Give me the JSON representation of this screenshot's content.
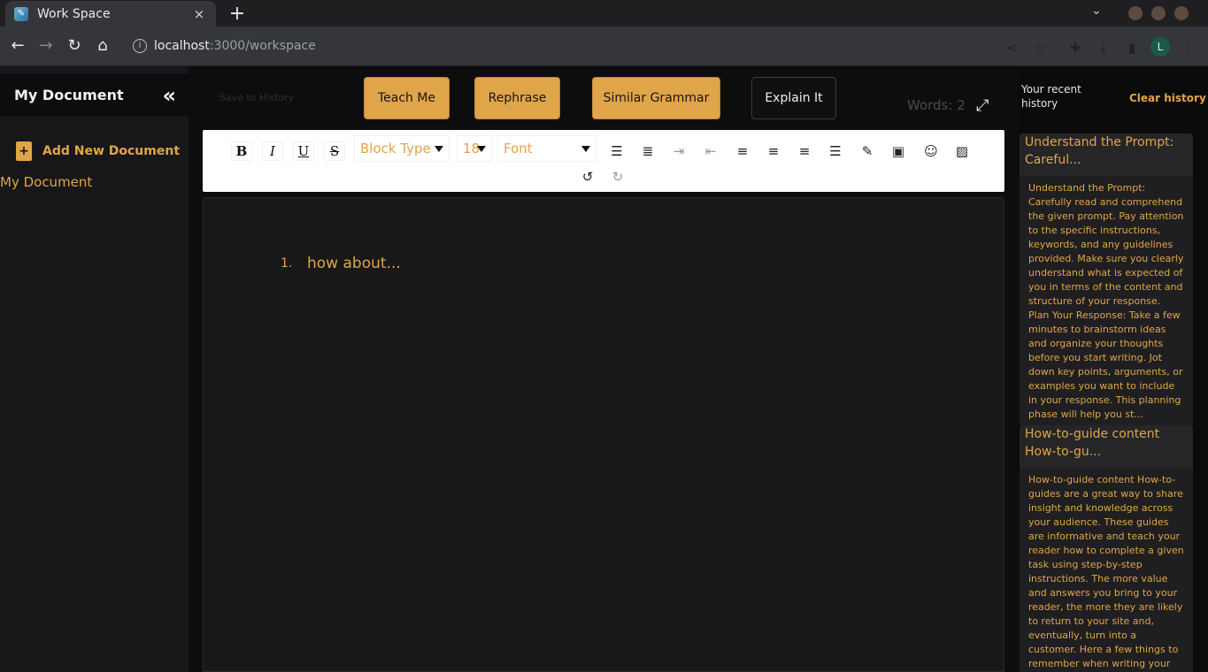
{
  "browser": {
    "tab_title": "Work Space",
    "tab_close": "×",
    "new_tab": "+",
    "url_host": "localhost",
    "url_path": ":3000/workspace",
    "profile_initial": "L"
  },
  "sidebar": {
    "title": "My Document",
    "collapse_icon": "«",
    "add_label": "Add New Document",
    "documents": [
      "My Document"
    ]
  },
  "main": {
    "save_to_history": "Save to History",
    "buttons": {
      "teach": "Teach Me",
      "rephrase": "Rephrase",
      "similar": "Similar Grammar",
      "explain": "Explain It"
    },
    "words": "Words: 2",
    "toolbar": {
      "bold": "B",
      "italic": "I",
      "underline": "U",
      "strike": "S",
      "block_type": "Block Type",
      "font_size": "18",
      "font": "Font"
    },
    "editor": {
      "list_number": "1.",
      "list_text": "how about..."
    }
  },
  "history": {
    "header": "Your recent history",
    "clear": "Clear history",
    "items": [
      {
        "title": "Understand the Prompt: Careful...",
        "body": "Understand the Prompt: Carefully read and comprehend the given prompt. Pay attention to the specific instructions, keywords, and any guidelines provided. Make sure you clearly understand what is expected of you in terms of the content and structure of your response. Plan Your Response: Take a few minutes to brainstorm ideas and organize your thoughts before you start writing. Jot down key points, arguments, or examples you want to include in your response. This planning phase will help you st..."
      },
      {
        "title": "How-to-guide content How-to-gu...",
        "body": "How-to-guide content How-to-guides are a great way to share insight and knowledge across your audience. These guides are informative and teach your reader how to complete a given task using step-by-step instructions. The more value and answers you bring to your reader, the more they are likely to return to your site and, eventually, turn into a customer. Here a few things to remember when writing your \"how-to-guide\":When listed that..."
      }
    ]
  },
  "colors": {
    "accent": "#e0a548",
    "background": "#101012",
    "panel": "#17171a"
  }
}
